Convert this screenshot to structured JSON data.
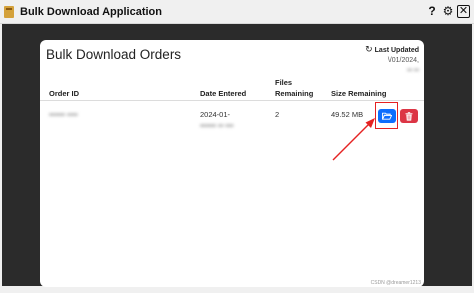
{
  "window": {
    "title": "Bulk Download Application",
    "help_glyph": "?",
    "settings_glyph": "⚙",
    "close_glyph": "✕"
  },
  "card": {
    "title": "Bulk Download Orders",
    "last_updated_label": "Last Updated",
    "last_updated_date": "\\/01/2024,",
    "last_updated_time": "▪▪ ▪▪",
    "refresh_icon": "↻"
  },
  "table": {
    "headers": {
      "order_id": "Order ID",
      "date_entered": "Date Entered",
      "files_remaining_line1": "Files",
      "files_remaining_line2": "Remaining",
      "size_remaining": "Size Remaining"
    },
    "rows": [
      {
        "order_id": "▪▪▪▪▪▪ ▪▪▪▪",
        "date_entered_line1": "2024-01-",
        "date_entered_line2": "▪▪▪▪▪▪ ▪▪ ▪▪▪",
        "files_remaining": "2",
        "size_remaining": "49.52 MB"
      }
    ]
  },
  "icons": {
    "open_folder": "folder-open-icon",
    "delete": "trash-icon"
  },
  "colors": {
    "open_button": "#0d6efd",
    "delete_button": "#dc3545",
    "annotation": "#e52222",
    "app_background": "#2b2b2b"
  },
  "watermark": "CSDN @dreamer1213"
}
